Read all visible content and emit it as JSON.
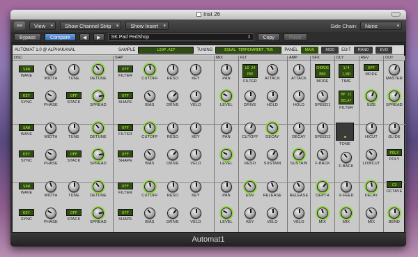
{
  "window": {
    "title": "Inst 26",
    "footer": "Automat1"
  },
  "toolbar": {
    "view": "View",
    "channel_strip": "Show Channel Strip",
    "insert": "Show Insert",
    "side_chain_label": "Side Chain:",
    "side_chain_value": "None"
  },
  "toolbar2": {
    "bypass": "Bypass",
    "compare": "Compare",
    "prev": "◀",
    "next": "▶",
    "preset": "SK Pad PedShop",
    "copy": "Copy",
    "paste": "Paste"
  },
  "header": {
    "name": "AUTOMAT 1.0 @ ALPHAKANAL",
    "sample_label": "SAMPLE",
    "sample_value": "LOOP.AIF",
    "tuning_label": "TUNING",
    "tuning_value": "EQUAL TEMPERAMENT.TUN",
    "panel_label": "PANEL",
    "panel_main": "MAIN",
    "panel_mod": "MOD",
    "edit_label": "EDIT",
    "rand": "RAND",
    "evo": "EVO"
  },
  "sections": [
    "OSC",
    "SHP",
    "MIX",
    "FLT",
    "AMP",
    "SFX",
    "DLY",
    "REV",
    "OUT"
  ],
  "osc": [
    {
      "wave": "SAW",
      "sync": "KEY",
      "stack": "OFF"
    },
    {
      "wave": "SAW",
      "sync": "KEY",
      "stack": "OFF"
    },
    {
      "wave": "SAW",
      "sync": "KEY",
      "stack": "OFF"
    }
  ],
  "labels": {
    "wave": "WAVE",
    "width": "WIDTH",
    "tune": "TUNE",
    "detune": "DETUNE",
    "sync": "SYNC",
    "phase": "PHASE",
    "stack": "STACK",
    "spread": "SPREAD",
    "filter": "FILTER",
    "cutoff": "CUTOFF",
    "reso": "RESO",
    "key": "KEY",
    "shape": "SHAPE",
    "bias": "BIAS",
    "drive": "DRIVE",
    "velo": "VELO",
    "pan": "PAN",
    "level": "LEVEL",
    "attack": "ATTACK",
    "hold": "HOLD",
    "decay": "DECAY",
    "sustain": "SUSTAIN",
    "release": "RELEASE",
    "env": "ENV",
    "mode": "MODE",
    "speed1": "SPEED1",
    "speed2": "SPEED2",
    "fback": "F-BACK",
    "depth": "DEPTH",
    "mix": "MIX",
    "time": "TIME",
    "tone": "TONE",
    "xfeed": "X-FEED",
    "size": "SIZE",
    "hicut": "HICUT",
    "lowcut": "LOWCUT",
    "delay": "DELAY",
    "master": "MASTER",
    "glide": "GLIDE",
    "poly": "POLY",
    "octave": "OCTAVE",
    "bend": "BEND"
  },
  "shp": {
    "filter": "OFF",
    "shape": "OFF"
  },
  "flt": {
    "filter": "LD 24\nPRE"
  },
  "sfx": {
    "mode": "CHORUS\nMOD"
  },
  "dly": {
    "time": "1/4\n1/8D",
    "filter": "HP 12\nDELAY"
  },
  "rev": {
    "mode": "OFF"
  },
  "out": {
    "poly": "POLY",
    "octave": "C3"
  },
  "accent": "#8ed637"
}
